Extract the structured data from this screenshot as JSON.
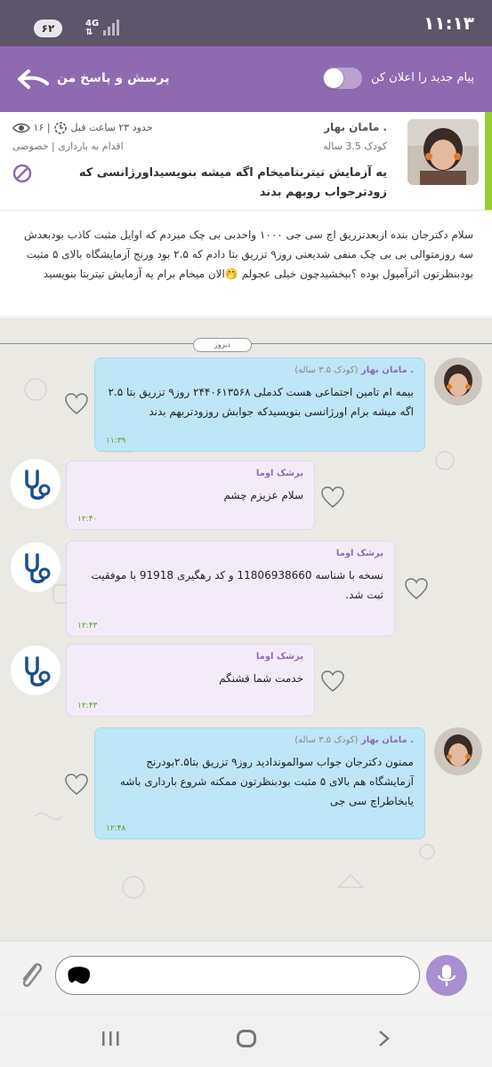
{
  "status_bar": {
    "time": "۱۱:۱۳",
    "battery": "۶۲",
    "network": "4G"
  },
  "header": {
    "title": "پرسش و پاسخ من",
    "notify_label": "پیام جدید را اعلان کن",
    "notify_enabled": false
  },
  "question": {
    "user_name": ". مامان بهار",
    "user_age": "کودک 3.5 ساله",
    "time_ago": "حدود ۲۳ ساعت قبل",
    "views": "۱۶",
    "tags": "اقدام به بارداری | خصوصی",
    "title": "یه آزمایش تیتربتامیخام اگه میشه بنویسیداورژانسی که زودترجواب روبهم بدند",
    "body": "سلام دکترجان بنده ازبعدتزریق اچ سی جی ۱۰۰۰ واحدبی بی چک میزدم که اوایل مثبت کاذب بودبعدش سه روزمتوالی بی بی چک منفی شدیعنی روز۹ تزریق بتا دادم که ۲.۵ بود ورنج آزمایشگاه بالای ۵ مثبت بودبنظرتون اثرآمپول بوده ؟ببخشیدچون خیلی عجولم 🤭الان میخام برام یه آزمایش تیتربتا بنویسید"
  },
  "chat": {
    "date_label": "دیروز",
    "messages": [
      {
        "sender": ". مامان بهار",
        "sender_sub": "(کودک ۳.۵ ساله)",
        "text": "بیمه ام تامین اجتماعی هست کدملی ۲۴۴۰۶۱۳۵۶۸ روز۹ تزریق بتا ۲.۵  اگه میشه برام اورژانسی بنویسیدکه جوابش روزودتربهم بدند",
        "time": "۱۱:۳۹"
      },
      {
        "sender": "پزشک اوما",
        "text": "سلام عزیزم چشم",
        "time": "۱۲:۴۰"
      },
      {
        "sender": "پزشک اوما",
        "text": "نسخه با شناسه 11806938660 و کد رهگیری 91918 با موفقیت ثبت شد.",
        "time": "۱۲:۴۳"
      },
      {
        "sender": "پزشک اوما",
        "text": "خدمت شما قشنگم",
        "time": "۱۲:۴۳"
      },
      {
        "sender": ". مامان بهار",
        "sender_sub": "(کودک ۳.۵ ساله)",
        "text": "ممنون دکترجان جواب سوالمونداديد  روز۹ تزریق بتا۲.۵بودرنج آزمایشگاه هم بالای ۵ مثبت بودبنظرتون ممکنه شروع بارداری باشه یابخاطراچ سی جی",
        "time": "۱۲:۴۸"
      }
    ]
  },
  "colors": {
    "header": "#8e6ab1",
    "status_bar": "#5d5569",
    "user_bubble": "#bde6f6",
    "doctor_bubble": "#f4ebf8",
    "accent_green": "#9acd32"
  },
  "icons": [
    "back-arrow-icon",
    "toggle-switch",
    "eye-icon",
    "clock-icon",
    "block-icon",
    "heart-icon",
    "stethoscope-icon",
    "paperclip-icon",
    "mic-icon",
    "recent-apps-icon",
    "home-icon",
    "back-icon"
  ]
}
